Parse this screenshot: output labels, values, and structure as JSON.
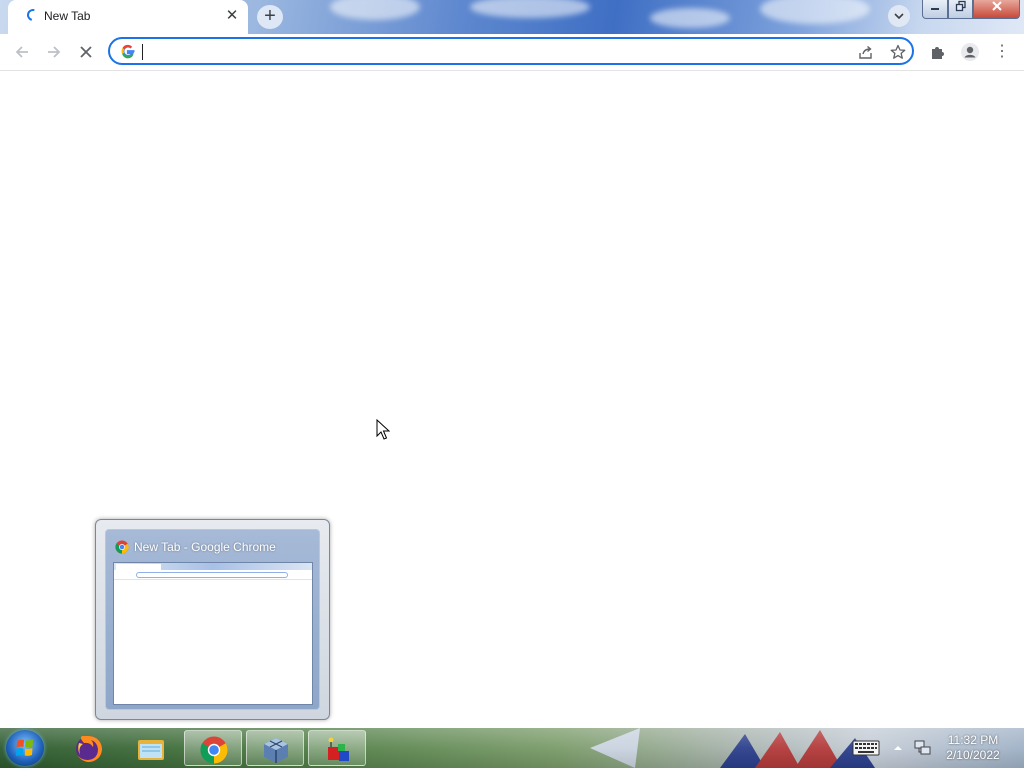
{
  "browser": {
    "tab": {
      "title": "New Tab",
      "close_glyph": "✕"
    },
    "new_tab_glyph": "+",
    "tab_search_glyph": "⌄",
    "window_controls": {
      "minimize": "▬",
      "maximize": "❐",
      "close": "✕"
    },
    "nav": {
      "back": "←",
      "forward": "→",
      "stop": "✕"
    },
    "omnibox": {
      "value": "",
      "share_icon": "share-icon",
      "bookmark_glyph": "☆"
    },
    "extensions_icon": "puzzle-icon",
    "profile_icon": "profile-icon",
    "menu_glyph": "⋮"
  },
  "taskbar_preview": {
    "title": "New Tab - Google Chrome"
  },
  "taskbar": {
    "apps": [
      {
        "name": "firefox",
        "icon": "firefox-icon"
      },
      {
        "name": "file-explorer",
        "icon": "folder-icon"
      },
      {
        "name": "chrome",
        "icon": "chrome-icon",
        "active": true
      },
      {
        "name": "virtualbox",
        "icon": "virtualbox-icon"
      },
      {
        "name": "app",
        "icon": "cube-app-icon"
      }
    ],
    "clock": {
      "time": "11:32 PM",
      "date": "2/10/2022"
    }
  },
  "colors": {
    "accent": "#1a73e8",
    "omnibox_border": "#1a73e8"
  }
}
